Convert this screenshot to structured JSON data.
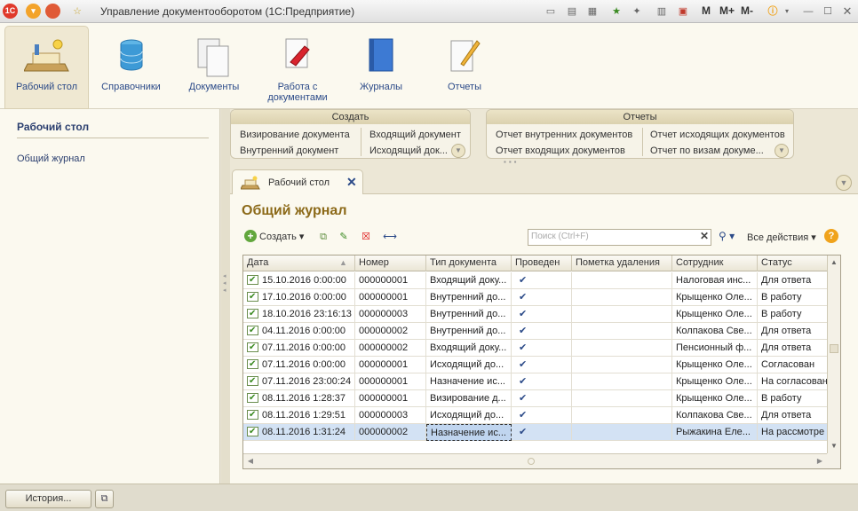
{
  "window": {
    "title": "Управление документооборотом (1С:Предприятие)",
    "logo_text": "1С",
    "toolbar_m": "M",
    "toolbar_mplus": "M+",
    "toolbar_mminus": "M-"
  },
  "sections": [
    {
      "label": "Рабочий стол",
      "icon": "desktop-icon",
      "active": true
    },
    {
      "label": "Справочники",
      "icon": "database-icon",
      "active": false
    },
    {
      "label": "Документы",
      "icon": "documents-icon",
      "active": false
    },
    {
      "label": "Работа с документами",
      "icon": "document-edit-icon",
      "active": false
    },
    {
      "label": "Журналы",
      "icon": "journal-book-icon",
      "active": false
    },
    {
      "label": "Отчеты",
      "icon": "report-icon",
      "active": false
    }
  ],
  "left_panel": {
    "title": "Рабочий стол",
    "items": [
      "Общий журнал"
    ]
  },
  "create_group": {
    "title": "Создать",
    "links": [
      "Визирование документа",
      "Внутренний документ",
      "Входящий документ",
      "Исходящий док..."
    ]
  },
  "reports_group": {
    "title": "Отчеты",
    "links": [
      "Отчет внутренних документов",
      "Отчет входящих документов",
      "Отчет исходящих документов",
      "Отчет по визам докуме..."
    ]
  },
  "tab": {
    "label": "Рабочий стол"
  },
  "form": {
    "title": "Общий журнал",
    "create_label": "Создать",
    "search_placeholder": "Поиск (Ctrl+F)",
    "all_actions": "Все действия"
  },
  "table": {
    "columns": [
      "Дата",
      "Номер",
      "Тип документа",
      "Проведен",
      "Пометка удаления",
      "Сотрудник",
      "Статус"
    ],
    "rows": [
      {
        "date": "15.10.2016 0:00:00",
        "number": "000000001",
        "type": "Входящий доку...",
        "posted": "✔",
        "deleted": "",
        "employee": "Налоговая инс...",
        "status": "Для ответа"
      },
      {
        "date": "17.10.2016 0:00:00",
        "number": "000000001",
        "type": "Внутренний до...",
        "posted": "✔",
        "deleted": "",
        "employee": "Крыщенко Оле...",
        "status": "В работу"
      },
      {
        "date": "18.10.2016 23:16:13",
        "number": "000000003",
        "type": "Внутренний до...",
        "posted": "✔",
        "deleted": "",
        "employee": "Крыщенко Оле...",
        "status": "В работу"
      },
      {
        "date": "04.11.2016 0:00:00",
        "number": "000000002",
        "type": "Внутренний до...",
        "posted": "✔",
        "deleted": "",
        "employee": "Колпакова Све...",
        "status": "Для ответа"
      },
      {
        "date": "07.11.2016 0:00:00",
        "number": "000000002",
        "type": "Входящий доку...",
        "posted": "✔",
        "deleted": "",
        "employee": "Пенсионный ф...",
        "status": "Для ответа"
      },
      {
        "date": "07.11.2016 0:00:00",
        "number": "000000001",
        "type": "Исходящий до...",
        "posted": "✔",
        "deleted": "",
        "employee": "Крыщенко Оле...",
        "status": "Согласован"
      },
      {
        "date": "07.11.2016 23:00:24",
        "number": "000000001",
        "type": "Назначение ис...",
        "posted": "✔",
        "deleted": "",
        "employee": "Крыщенко Оле...",
        "status": "На согласован"
      },
      {
        "date": "08.11.2016 1:28:37",
        "number": "000000001",
        "type": "Визирование д...",
        "posted": "✔",
        "deleted": "",
        "employee": "Крыщенко Оле...",
        "status": "В работу"
      },
      {
        "date": "08.11.2016 1:29:51",
        "number": "000000003",
        "type": "Исходящий до...",
        "posted": "✔",
        "deleted": "",
        "employee": "Колпакова Све...",
        "status": "Для ответа"
      },
      {
        "date": "08.11.2016 1:31:24",
        "number": "000000002",
        "type": "Назначение ис...",
        "posted": "✔",
        "deleted": "",
        "employee": "Рыжакина Еле...",
        "status": "На рассмотре",
        "selected": true
      }
    ]
  },
  "statusbar": {
    "history_label": "История..."
  }
}
